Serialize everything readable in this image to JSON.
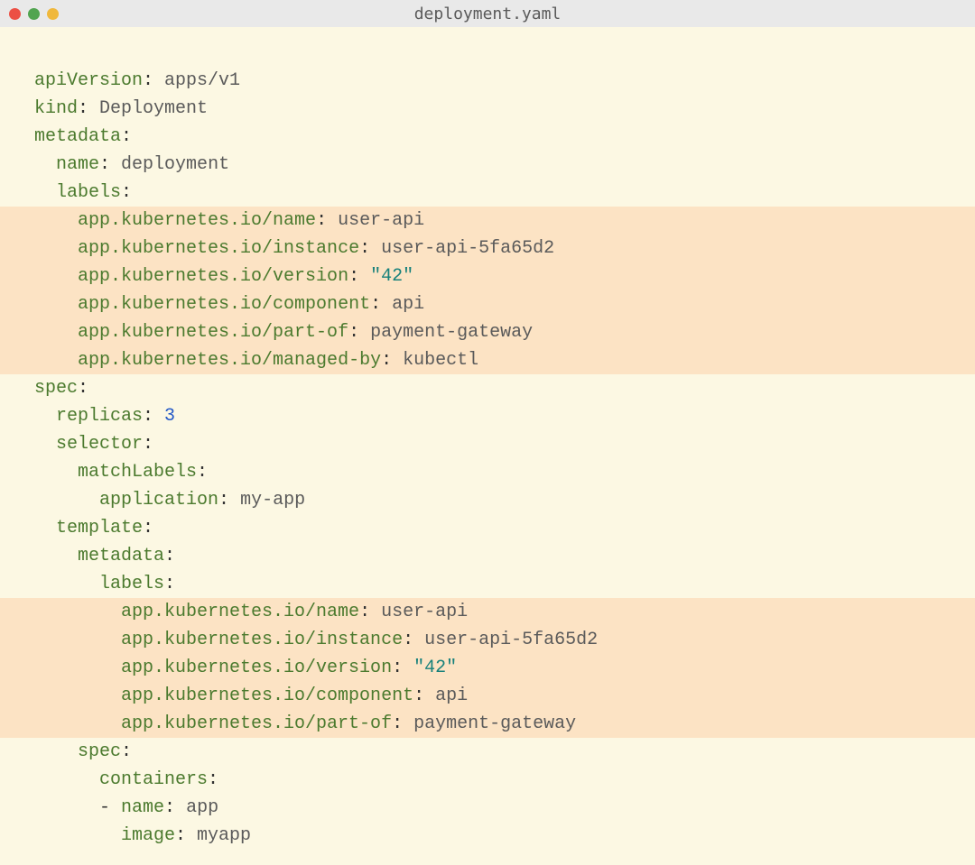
{
  "window": {
    "title": "deployment.yaml"
  },
  "yaml": {
    "apiVersion": {
      "key": "apiVersion",
      "val": "apps/v1"
    },
    "kind": {
      "key": "kind",
      "val": "Deployment"
    },
    "metadata": {
      "key": "metadata"
    },
    "meta_name": {
      "key": "name",
      "val": "deployment"
    },
    "meta_labels": {
      "key": "labels"
    },
    "label_name": {
      "key": "app.kubernetes.io/name",
      "val": "user-api"
    },
    "label_instance": {
      "key": "app.kubernetes.io/instance",
      "val": "user-api-5fa65d2"
    },
    "label_version": {
      "key": "app.kubernetes.io/version",
      "val": "\"42\""
    },
    "label_component": {
      "key": "app.kubernetes.io/component",
      "val": "api"
    },
    "label_partof": {
      "key": "app.kubernetes.io/part-of",
      "val": "payment-gateway"
    },
    "label_managedby": {
      "key": "app.kubernetes.io/managed-by",
      "val": "kubectl"
    },
    "spec": {
      "key": "spec"
    },
    "replicas": {
      "key": "replicas",
      "val": "3"
    },
    "selector": {
      "key": "selector"
    },
    "matchLabels": {
      "key": "matchLabels"
    },
    "ml_application": {
      "key": "application",
      "val": "my-app"
    },
    "template": {
      "key": "template"
    },
    "tmpl_metadata": {
      "key": "metadata"
    },
    "tmpl_labels": {
      "key": "labels"
    },
    "tl_name": {
      "key": "app.kubernetes.io/name",
      "val": "user-api"
    },
    "tl_instance": {
      "key": "app.kubernetes.io/instance",
      "val": "user-api-5fa65d2"
    },
    "tl_version": {
      "key": "app.kubernetes.io/version",
      "val": "\"42\""
    },
    "tl_component": {
      "key": "app.kubernetes.io/component",
      "val": "api"
    },
    "tl_partof": {
      "key": "app.kubernetes.io/part-of",
      "val": "payment-gateway"
    },
    "tmpl_spec": {
      "key": "spec"
    },
    "containers": {
      "key": "containers"
    },
    "ctr_dash": "- ",
    "ctr_name": {
      "key": "name",
      "val": "app"
    },
    "ctr_image": {
      "key": "image",
      "val": "myapp"
    }
  }
}
